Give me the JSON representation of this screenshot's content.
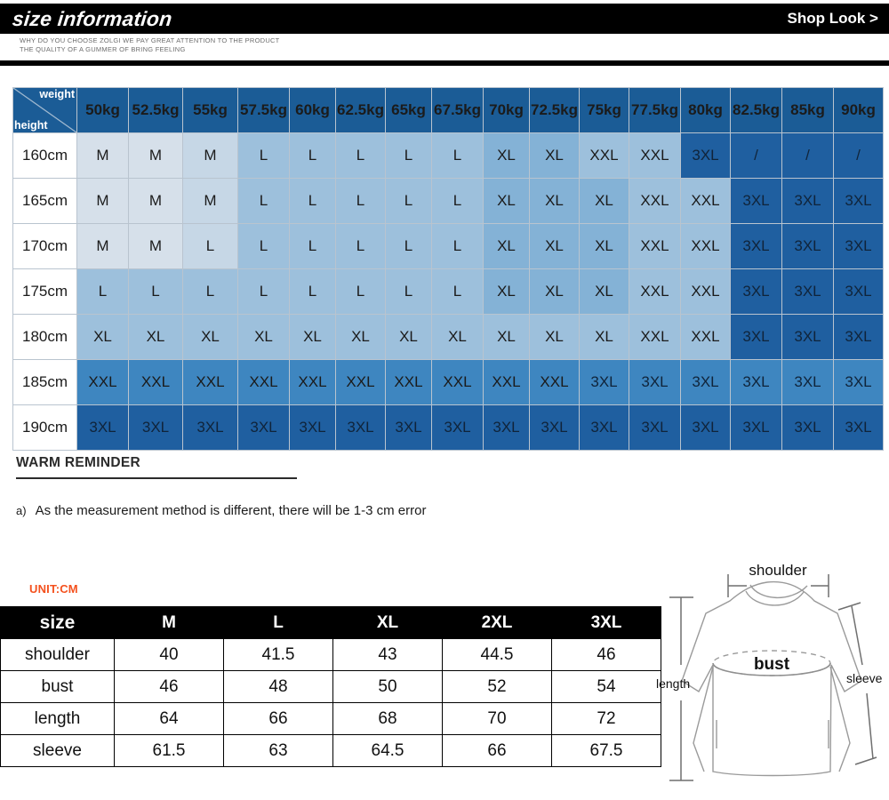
{
  "header": {
    "title": "size information",
    "link_label": "Shop Look >",
    "subcopy_line1": "WHY DO YOU CHOOSE ZOLGI WE PAY GREAT ATTENTION TO THE PRODUCT",
    "subcopy_line2": "THE QUALITY OF A GUMMER OF BRING FEELING"
  },
  "size_grid": {
    "corner": {
      "weight_label": "weight",
      "height_label": "height"
    },
    "weights": [
      "50kg",
      "52.5kg",
      "55kg",
      "57.5kg",
      "60kg",
      "62.5kg",
      "65kg",
      "67.5kg",
      "70kg",
      "72.5kg",
      "75kg",
      "77.5kg",
      "80kg",
      "82.5kg",
      "85kg",
      "90kg"
    ],
    "heights": [
      "160cm",
      "165cm",
      "170cm",
      "175cm",
      "180cm",
      "185cm",
      "190cm"
    ],
    "rows": [
      [
        "M",
        "M",
        "M",
        "L",
        "L",
        "L",
        "L",
        "L",
        "XL",
        "XL",
        "XXL",
        "XXL",
        "3XL",
        "/",
        "/",
        "/"
      ],
      [
        "M",
        "M",
        "M",
        "L",
        "L",
        "L",
        "L",
        "L",
        "XL",
        "XL",
        "XL",
        "XXL",
        "XXL",
        "3XL",
        "3XL",
        "3XL"
      ],
      [
        "M",
        "M",
        "L",
        "L",
        "L",
        "L",
        "L",
        "L",
        "XL",
        "XL",
        "XL",
        "XXL",
        "XXL",
        "3XL",
        "3XL",
        "3XL"
      ],
      [
        "L",
        "L",
        "L",
        "L",
        "L",
        "L",
        "L",
        "L",
        "XL",
        "XL",
        "XL",
        "XXL",
        "XXL",
        "3XL",
        "3XL",
        "3XL"
      ],
      [
        "XL",
        "XL",
        "XL",
        "XL",
        "XL",
        "XL",
        "XL",
        "XL",
        "XL",
        "XL",
        "XL",
        "XXL",
        "XXL",
        "3XL",
        "3XL",
        "3XL"
      ],
      [
        "XXL",
        "XXL",
        "XXL",
        "XXL",
        "XXL",
        "XXL",
        "XXL",
        "XXL",
        "XXL",
        "XXL",
        "3XL",
        "3XL",
        "3XL",
        "3XL",
        "3XL",
        "3XL"
      ],
      [
        "3XL",
        "3XL",
        "3XL",
        "3XL",
        "3XL",
        "3XL",
        "3XL",
        "3XL",
        "3XL",
        "3XL",
        "3XL",
        "3XL",
        "3XL",
        "3XL",
        "3XL",
        "3XL"
      ]
    ],
    "colors": {
      "header_blue": "#1b5c96",
      "tint_lightest": "#d6e0ea",
      "tint_light": "#c6d7e6",
      "tint_mid": "#9dc0dc",
      "tint_mid2": "#84b2d6",
      "tint_dark": "#3e86c0",
      "tint_darkest": "#1f5fa0"
    }
  },
  "warm_reminder": {
    "title": "WARM REMINDER",
    "items": [
      {
        "marker": "a)",
        "text": "As the measurement method is different, there will be 1-3 cm error"
      }
    ]
  },
  "measurements": {
    "unit_label": "UNIT:CM",
    "columns": [
      "size",
      "M",
      "L",
      "XL",
      "2XL",
      "3XL"
    ],
    "rows": [
      {
        "label": "shoulder",
        "values": [
          "40",
          "41.5",
          "43",
          "44.5",
          "46"
        ]
      },
      {
        "label": "bust",
        "values": [
          "46",
          "48",
          "50",
          "52",
          "54"
        ]
      },
      {
        "label": "length",
        "values": [
          "64",
          "66",
          "68",
          "70",
          "72"
        ]
      },
      {
        "label": "sleeve",
        "values": [
          "61.5",
          "63",
          "64.5",
          "66",
          "67.5"
        ]
      }
    ]
  },
  "diagram": {
    "shoulder_label": "shoulder",
    "bust_label": "bust",
    "length_label": "length",
    "sleeve_label": "sleeve"
  }
}
